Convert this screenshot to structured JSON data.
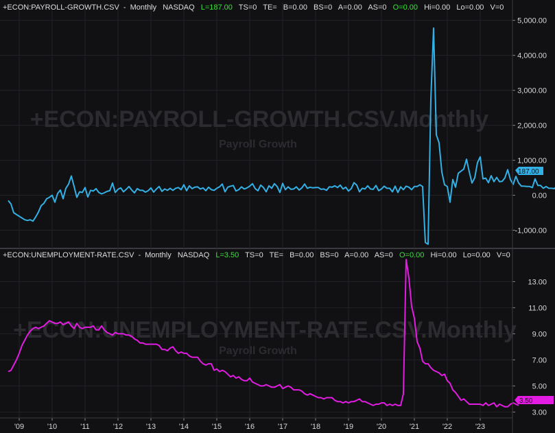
{
  "colors": {
    "background": "#111113",
    "grid": "#232328",
    "axis_text": "#d8d8d8",
    "header_text": "#dedede",
    "header_green": "#35e635",
    "payroll_line": "#33b1e6",
    "unemployment_line": "#e21ce2",
    "watermark": "#2b2b30"
  },
  "panels": [
    {
      "header": {
        "symbol": "+ECON:PAYROLL-GROWTH.CSV",
        "period": "Monthly",
        "exchange": "NASDAQ",
        "last": "L=187.00",
        "ts": "TS=0",
        "te": "TE=",
        "b": "B=0.00",
        "bs": "BS=0",
        "a": "A=0.00",
        "as": "AS=0",
        "open": "O=0.00",
        "hi": "Hi=0.00",
        "lo": "Lo=0.00",
        "v": "V=0"
      },
      "watermark_title": "+ECON:PAYROLL-GROWTH.CSV.Monthly",
      "watermark_subtitle": "Payroll Growth",
      "last_value_label": "187.00"
    },
    {
      "header": {
        "symbol": "+ECON:UNEMPLOYMENT-RATE.CSV",
        "period": "Monthly",
        "exchange": "NASDAQ",
        "last": "L=3.50",
        "ts": "TS=0",
        "te": "TE=",
        "b": "B=0.00",
        "bs": "BS=0",
        "a": "A=0.00",
        "as": "AS=0",
        "open": "O=0.00",
        "hi": "Hi=0.00",
        "lo": "Lo=0.00",
        "v": "V=0"
      },
      "watermark_title": "+ECON:UNEMPLOYMENT-RATE.CSV.Monthly",
      "watermark_subtitle": "Payroll Growth",
      "last_value_label": "3.50"
    }
  ],
  "chart_data": [
    {
      "type": "line",
      "x_tick_labels": [
        "'09",
        "'10",
        "'11",
        "'12",
        "'13",
        "'14",
        "'15",
        "'16",
        "'17",
        "'18",
        "'19",
        "'20",
        "'21",
        "'22",
        "'23"
      ],
      "y_tick_labels": [
        "5,000.00",
        "4,000.00",
        "3,000.00",
        "2,000.00",
        "1,000.00",
        "0.00",
        "-1,000.00"
      ],
      "ylim": [
        -1480,
        5150
      ],
      "x_start": [
        2008,
        9
      ],
      "series": [
        {
          "color": "#33b1e6",
          "last": 187,
          "values": [
            -150,
            -250,
            -500,
            -550,
            -600,
            -650,
            -700,
            -720,
            -700,
            -740,
            -620,
            -480,
            -300,
            -230,
            -100,
            -60,
            0,
            -200,
            50,
            150,
            -100,
            200,
            320,
            550,
            250,
            -60,
            100,
            80,
            220,
            -50,
            140,
            120,
            190,
            80,
            40,
            70,
            110,
            130,
            350,
            80,
            170,
            210,
            100,
            170,
            250,
            150,
            70,
            190,
            140,
            140,
            90,
            130,
            210,
            90,
            180,
            250,
            110,
            180,
            140,
            200,
            140,
            200,
            220,
            160,
            300,
            130,
            270,
            190,
            230,
            240,
            180,
            210,
            130,
            230,
            160,
            140,
            200,
            240,
            320,
            100,
            230,
            260,
            280,
            120,
            160,
            240,
            180,
            210,
            260,
            330,
            190,
            130,
            290,
            220,
            100,
            270,
            200,
            330,
            250,
            80,
            340,
            160,
            240,
            170,
            180,
            240,
            150,
            210,
            320,
            200,
            230,
            210,
            220,
            220,
            170,
            180,
            140,
            240,
            230,
            270,
            220,
            290,
            180,
            230,
            120,
            190,
            360,
            290,
            100,
            200,
            180,
            270,
            180,
            170,
            280,
            130,
            180,
            260,
            200,
            200,
            100,
            260,
            80,
            240,
            160,
            260,
            230,
            160,
            250,
            250,
            300,
            250,
            -1350,
            -1400,
            2730,
            4780,
            1730,
            1500,
            670,
            300,
            250,
            -200,
            450,
            230,
            630,
            690,
            750,
            1030,
            670,
            350,
            500,
            930,
            1100,
            470,
            490,
            360,
            560,
            390,
            510,
            390,
            400,
            500,
            730,
            450,
            310,
            540,
            350,
            260,
            260,
            250,
            250,
            220,
            470,
            280,
            280,
            200,
            250,
            200,
            200,
            190,
            260,
            180,
            230,
            187
          ]
        }
      ]
    },
    {
      "type": "line",
      "x_tick_labels": [
        "'09",
        "'10",
        "'11",
        "'12",
        "'13",
        "'14",
        "'15",
        "'16",
        "'17",
        "'18",
        "'19",
        "'20",
        "'21",
        "'22",
        "'23"
      ],
      "y_tick_labels": [
        "13.00",
        "11.00",
        "9.00",
        "7.00",
        "5.00",
        "3.00"
      ],
      "ylim": [
        2.6,
        14.6
      ],
      "x_start": [
        2008,
        9
      ],
      "series": [
        {
          "color": "#e21ce2",
          "last": 3.5,
          "values": [
            6.1,
            6.2,
            6.6,
            7.0,
            7.5,
            8.1,
            8.5,
            8.9,
            9.2,
            9.4,
            9.5,
            9.4,
            9.5,
            9.6,
            9.8,
            10.0,
            9.9,
            9.8,
            9.8,
            9.9,
            9.7,
            9.8,
            9.9,
            9.6,
            9.4,
            9.8,
            9.5,
            9.4,
            9.5,
            9.5,
            9.5,
            9.6,
            9.3,
            9.3,
            9.6,
            9.3,
            9.1,
            9.0,
            8.9,
            9.1,
            9.0,
            9.0,
            9.0,
            8.9,
            8.9,
            8.8,
            8.6,
            8.5,
            8.3,
            8.3,
            8.2,
            8.2,
            8.2,
            8.2,
            8.2,
            8.1,
            7.8,
            7.8,
            7.7,
            7.9,
            8.0,
            7.7,
            7.5,
            7.6,
            7.5,
            7.5,
            7.3,
            7.2,
            7.2,
            7.2,
            6.9,
            6.7,
            6.6,
            6.7,
            6.7,
            6.2,
            6.3,
            6.1,
            6.2,
            6.1,
            5.9,
            5.7,
            5.8,
            5.6,
            5.7,
            5.5,
            5.4,
            5.4,
            5.6,
            5.3,
            5.2,
            5.1,
            5.0,
            5.0,
            5.1,
            5.0,
            4.9,
            4.9,
            5.0,
            5.1,
            4.8,
            4.9,
            5.0,
            4.9,
            4.7,
            4.7,
            4.7,
            4.6,
            4.4,
            4.3,
            4.4,
            4.3,
            4.2,
            4.1,
            4.1,
            4.0,
            4.1,
            4.1,
            4.1,
            3.9,
            3.8,
            3.8,
            3.7,
            3.8,
            3.7,
            3.8,
            3.8,
            3.9,
            4.0,
            3.8,
            3.8,
            3.7,
            3.6,
            3.5,
            3.6,
            3.6,
            3.7,
            3.7,
            3.5,
            3.6,
            3.5,
            3.6,
            3.5,
            3.5,
            4.4,
            14.7,
            13.3,
            11.1,
            10.2,
            8.4,
            7.9,
            6.9,
            6.7,
            6.7,
            6.4,
            6.2,
            6.1,
            6.0,
            5.8,
            5.9,
            5.4,
            5.2,
            4.7,
            4.5,
            4.2,
            3.9,
            4.0,
            3.8,
            3.6,
            3.6,
            3.6,
            3.6,
            3.6,
            3.5,
            3.7,
            3.5,
            3.6,
            3.7,
            3.4,
            3.6,
            3.5,
            3.4,
            3.4,
            3.6,
            3.7,
            3.6,
            3.5
          ]
        }
      ]
    }
  ]
}
